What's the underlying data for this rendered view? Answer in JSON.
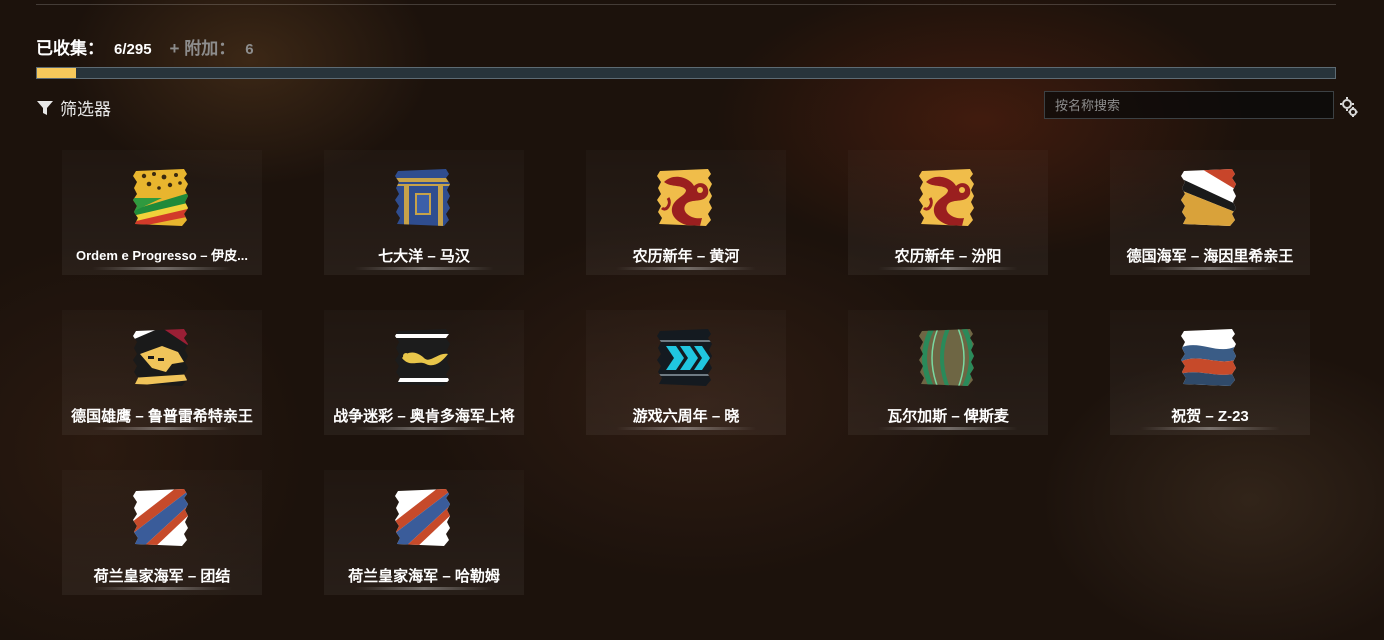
{
  "header": {
    "collected_label": "已收集：",
    "collected_count": "6/295",
    "extra_label": "+ 附加：",
    "extra_count": "6",
    "progress_fraction": 0.03
  },
  "toolbar": {
    "filter_label": "筛选器",
    "search_placeholder": "按名称搜索"
  },
  "items": [
    {
      "label": "Ordem e Progresso – 伊皮...",
      "icon": "flag-brazil-jaguar"
    },
    {
      "label": "七大洋 – 马汉",
      "icon": "flag-seven-seas"
    },
    {
      "label": "农历新年 – 黄河",
      "icon": "flag-lunar-dragon"
    },
    {
      "label": "农历新年 – 汾阳",
      "icon": "flag-lunar-dragon"
    },
    {
      "label": "德国海军 – 海因里希亲王",
      "icon": "flag-german-navy"
    },
    {
      "label": "德国雄鹰 – 鲁普雷希特亲王",
      "icon": "flag-german-eagle"
    },
    {
      "label": "战争迷彩 – 奥肯多海军上将",
      "icon": "flag-war-camo"
    },
    {
      "label": "游戏六周年 – 晓",
      "icon": "flag-sixth-anniversary"
    },
    {
      "label": "瓦尔加斯 – 俾斯麦",
      "icon": "flag-valhalla"
    },
    {
      "label": "祝贺 – Z-23",
      "icon": "flag-congrats"
    },
    {
      "label": "荷兰皇家海军 – 团结",
      "icon": "flag-dutch-navy"
    },
    {
      "label": "荷兰皇家海军 – 哈勒姆",
      "icon": "flag-dutch-navy"
    }
  ]
}
